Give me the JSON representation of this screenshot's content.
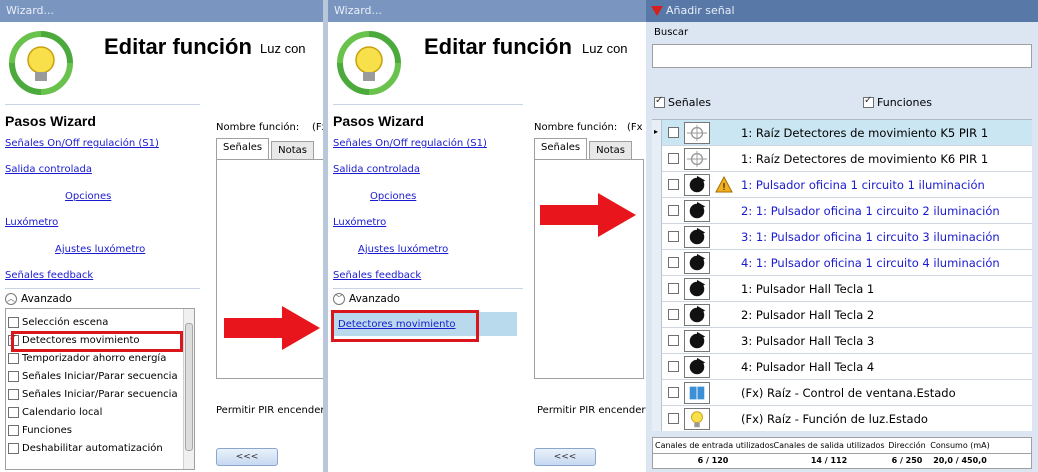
{
  "panel_left": {
    "window_title": "Wizard...",
    "title": "Editar función",
    "subtitle": "Luz con",
    "steps_heading": "Pasos Wizard",
    "steps": [
      {
        "label": "Señales On/Off regulación (S1)"
      },
      {
        "label": "Salida controlada"
      },
      {
        "label": "Opciones"
      },
      {
        "label": "Luxómetro"
      },
      {
        "label": "Ajustes luxómetro"
      },
      {
        "label": "Señales feedback"
      }
    ],
    "advanced_label": "Avanzado",
    "advanced_items": [
      {
        "label": "Selección escena",
        "checked": false
      },
      {
        "label": "Detectores movimiento",
        "checked": true
      },
      {
        "label": "Temporizador ahorro energía",
        "checked": false
      },
      {
        "label": "Señales Iniciar/Parar secuencia",
        "checked": false
      },
      {
        "label": "Señales Iniciar/Parar secuencia",
        "checked": false
      },
      {
        "label": "Calendario local",
        "checked": false
      },
      {
        "label": "Funciones",
        "checked": false
      },
      {
        "label": "Deshabilitar automatización",
        "checked": false
      }
    ],
    "name_label": "Nombre función:",
    "name_value": "(Fx)",
    "tab_signals": "Señales",
    "tab_notes": "Notas",
    "pir_label": "Permitir PIR encender",
    "back_button": "<<<"
  },
  "panel_mid": {
    "window_title": "Wizard...",
    "title": "Editar función",
    "subtitle": "Luz con",
    "steps_heading": "Pasos Wizard",
    "steps": [
      {
        "label": "Señales On/Off regulación (S1)"
      },
      {
        "label": "Salida controlada"
      },
      {
        "label": "Opciones"
      },
      {
        "label": "Luxómetro"
      },
      {
        "label": "Ajustes luxómetro"
      },
      {
        "label": "Señales feedback"
      }
    ],
    "advanced_label": "Avanzado",
    "selected_item": "Detectores movimiento",
    "name_label": "Nombre función:",
    "name_value": "(Fx",
    "tab_signals": "Señales",
    "tab_notes": "Notas",
    "pir_label": "Permitir PIR encender",
    "back_button": "<<<"
  },
  "panel_right": {
    "window_title": "Añadir señal",
    "search_label": "Buscar",
    "search_value": "",
    "check_signals": "Señales",
    "check_functions": "Funciones",
    "rows": [
      {
        "text": "1: Raíz Detectores de movimiento K5 PIR 1",
        "icon": "pir-sensor-icon",
        "link": false,
        "warn": false
      },
      {
        "text": "1: Raíz Detectores de movimiento K6 PIR 1",
        "icon": "pir-sensor-icon",
        "link": false,
        "warn": false
      },
      {
        "text": "1: Pulsador oficina 1 circuito 1 iluminación",
        "icon": "pushbutton-icon",
        "link": true,
        "warn": true
      },
      {
        "text": "2: 1: Pulsador oficina 1 circuito 2 iluminación",
        "icon": "pushbutton-icon",
        "link": true,
        "warn": false
      },
      {
        "text": "3: 1: Pulsador oficina 1 circuito 3 iluminación",
        "icon": "pushbutton-icon",
        "link": true,
        "warn": false
      },
      {
        "text": "4: 1: Pulsador oficina 1 circuito 4 iluminación",
        "icon": "pushbutton-icon",
        "link": true,
        "warn": false
      },
      {
        "text": "1: Pulsador Hall Tecla 1",
        "icon": "pushbutton-icon",
        "link": false,
        "warn": false
      },
      {
        "text": "2: Pulsador Hall Tecla 2",
        "icon": "pushbutton-icon",
        "link": false,
        "warn": false
      },
      {
        "text": "3: Pulsador Hall Tecla 3",
        "icon": "pushbutton-icon",
        "link": false,
        "warn": false
      },
      {
        "text": "4: Pulsador Hall Tecla 4",
        "icon": "pushbutton-icon",
        "link": false,
        "warn": false
      },
      {
        "text": "(Fx) Raíz - Control de ventana.Estado",
        "icon": "window-icon",
        "link": false,
        "warn": false
      },
      {
        "text": "(Fx) Raíz - Función de luz.Estado",
        "icon": "lightbulb-icon",
        "link": false,
        "warn": false
      }
    ],
    "stats": {
      "in_label": "Canales de entrada utilizados",
      "in_value": "6 / 120",
      "out_label": "Canales de salida utilizados",
      "out_value": "14 / 112",
      "dir_label": "Dirección",
      "dir_value": "6 / 250",
      "power_label": "Consumo (mA)",
      "power_value": "20,0 / 450,0"
    }
  },
  "colors": {
    "link": "#1a1ad0",
    "highlight": "#d9161c",
    "arrow": "#e8161c"
  }
}
